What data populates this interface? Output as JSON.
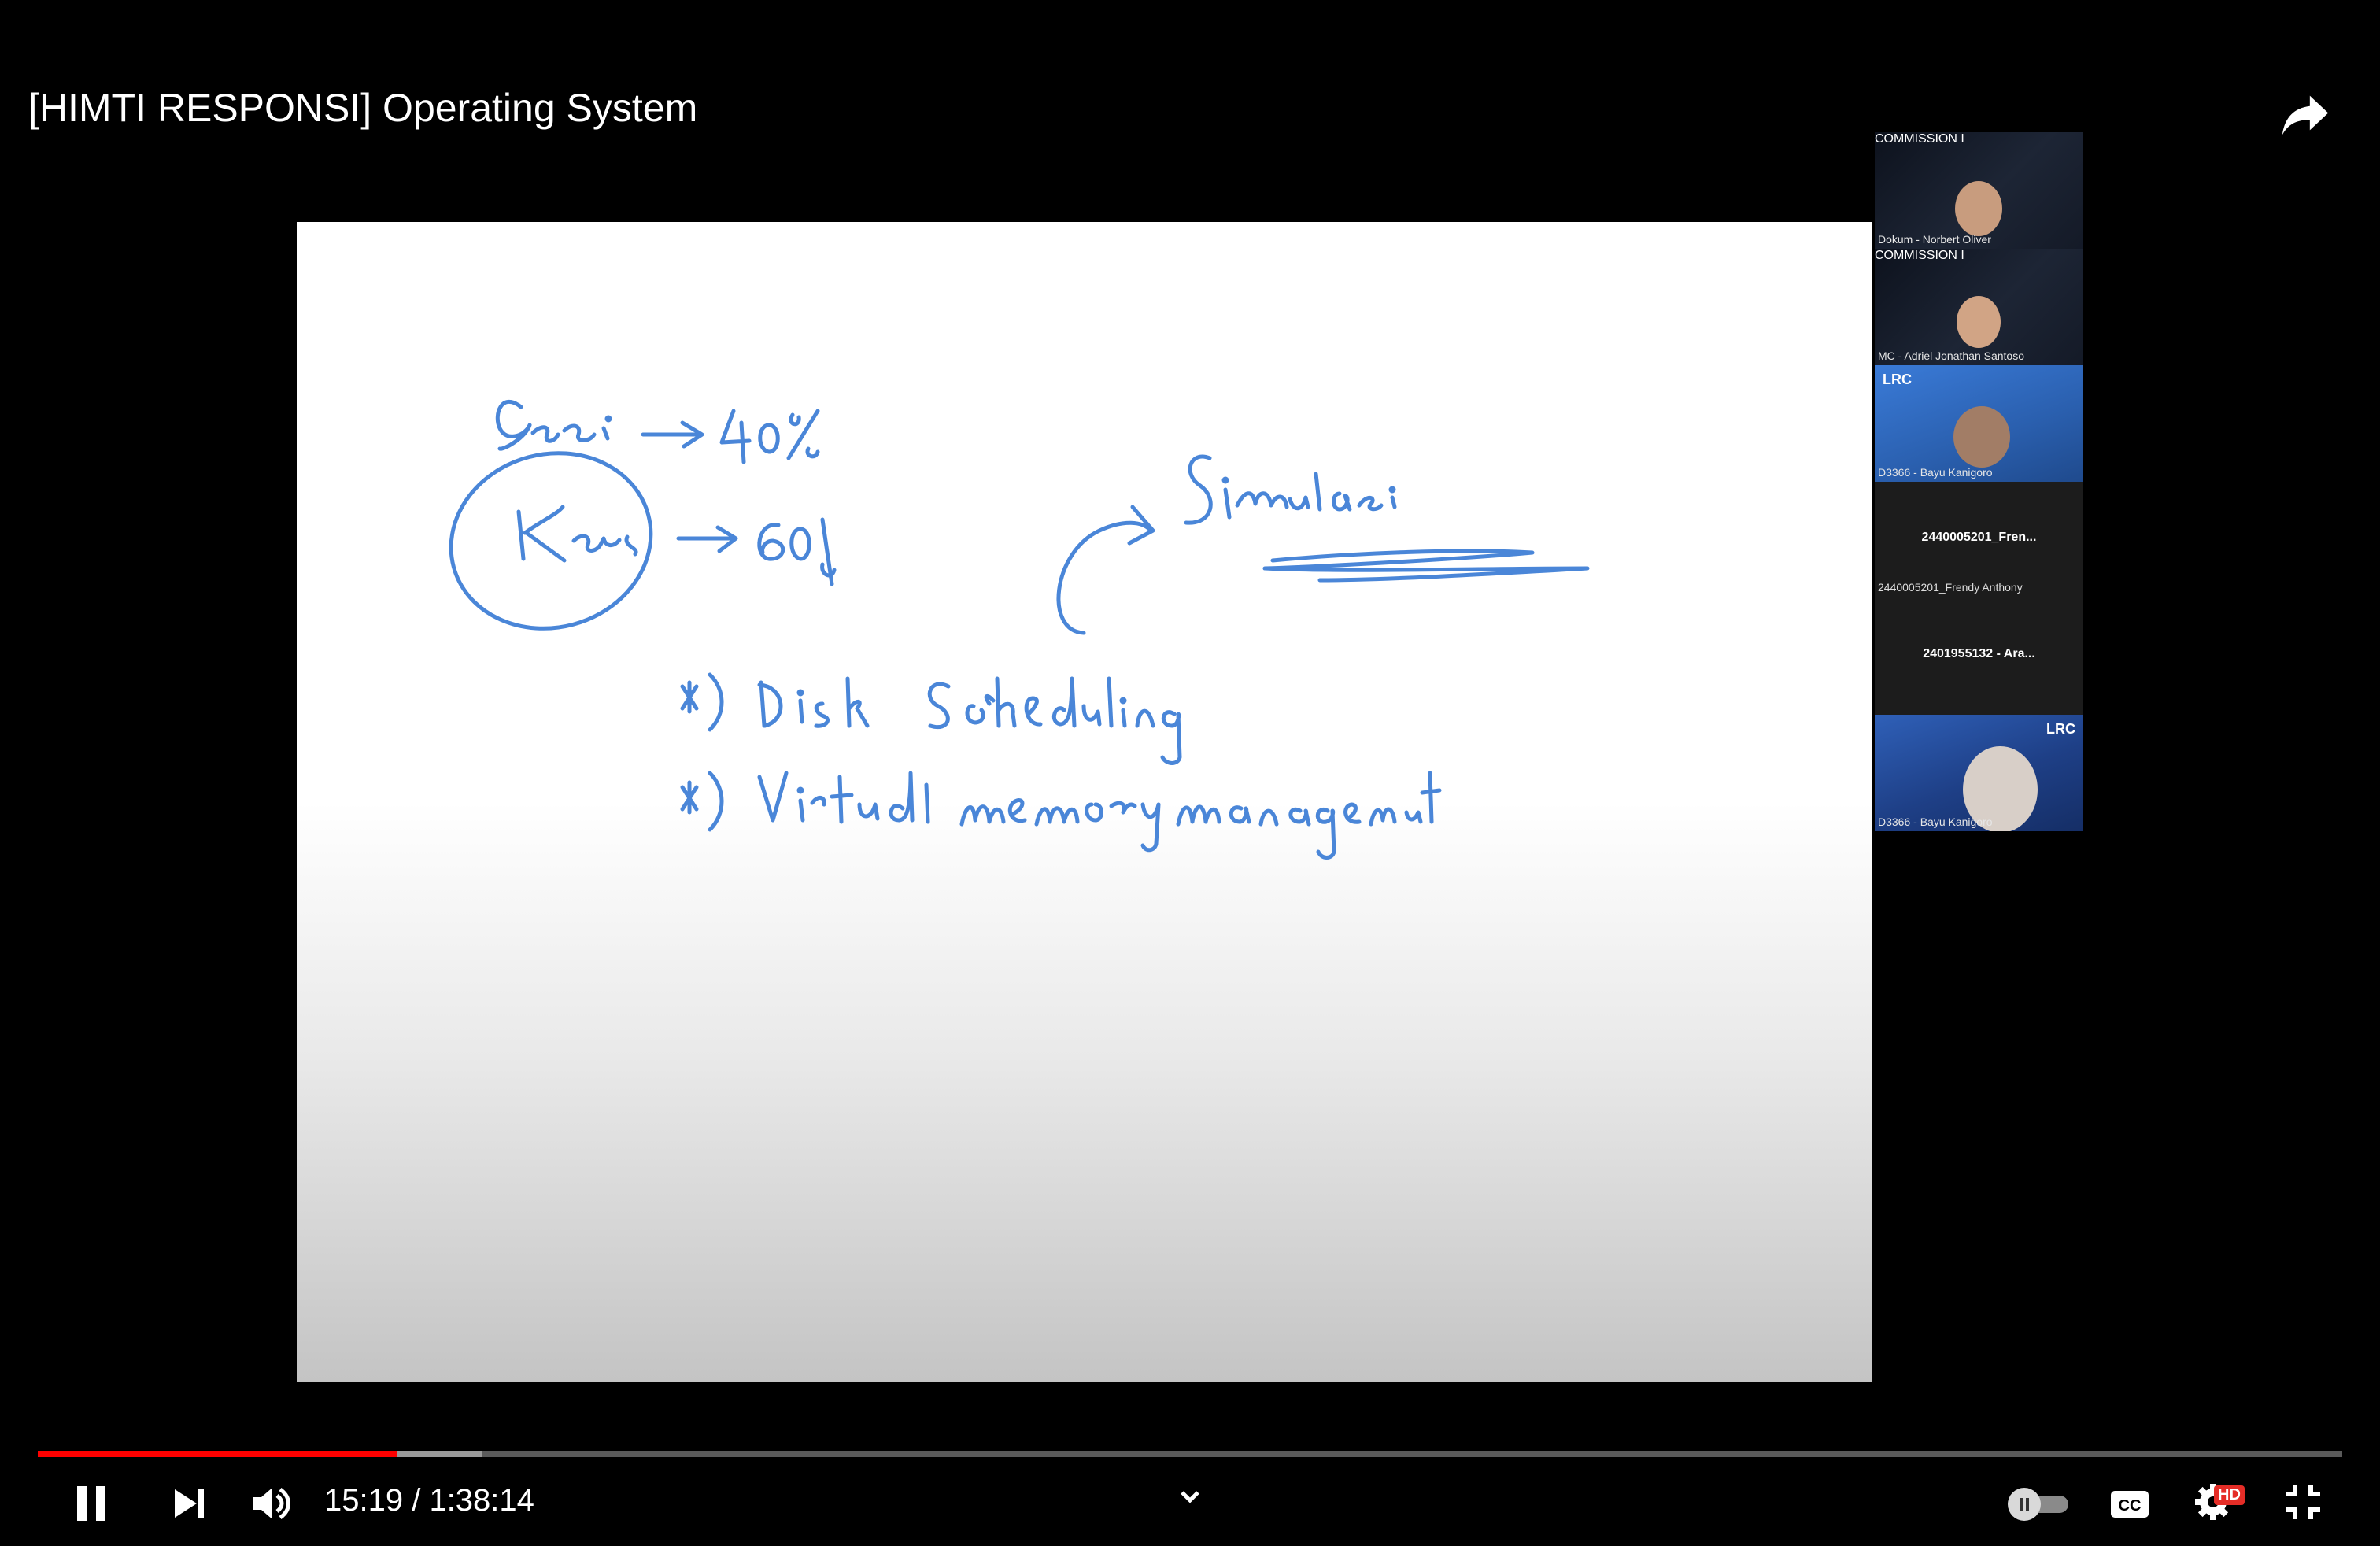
{
  "video": {
    "title": "[HIMTI RESPONSI] Operating System"
  },
  "participants": [
    {
      "caption": "Dokum - Norbert Oliver",
      "brand": "COMMISSION I"
    },
    {
      "caption": "MC - Adriel Jonathan Santoso",
      "brand": "COMMISSION I"
    },
    {
      "caption": "D3366 - Bayu Kanigoro",
      "logo": "LRC"
    },
    {
      "name": "2440005201_Fren...",
      "subname": "2440005201_Frendy Anthony"
    },
    {
      "name": "2401955132 - Ara..."
    },
    {
      "caption": "D3366 - Bayu Kanigoro",
      "logo": "LRC"
    }
  ],
  "player": {
    "current_time": "15:19",
    "duration": "1:38:14",
    "time_display": "15:19 / 1:38:14",
    "progress_fraction": 0.156,
    "buffered_fraction": 0.193,
    "hd_label": "HD",
    "accent_color": "#ff0000"
  },
  "icons": [
    "share-icon",
    "pause-icon",
    "next-icon",
    "volume-icon",
    "chevron-down-icon",
    "autoplay-toggle-icon",
    "cc-icon",
    "settings-icon",
    "exit-fullscreen-icon"
  ],
  "colors": {
    "ink": "#4a86d8",
    "background": "#000000"
  }
}
